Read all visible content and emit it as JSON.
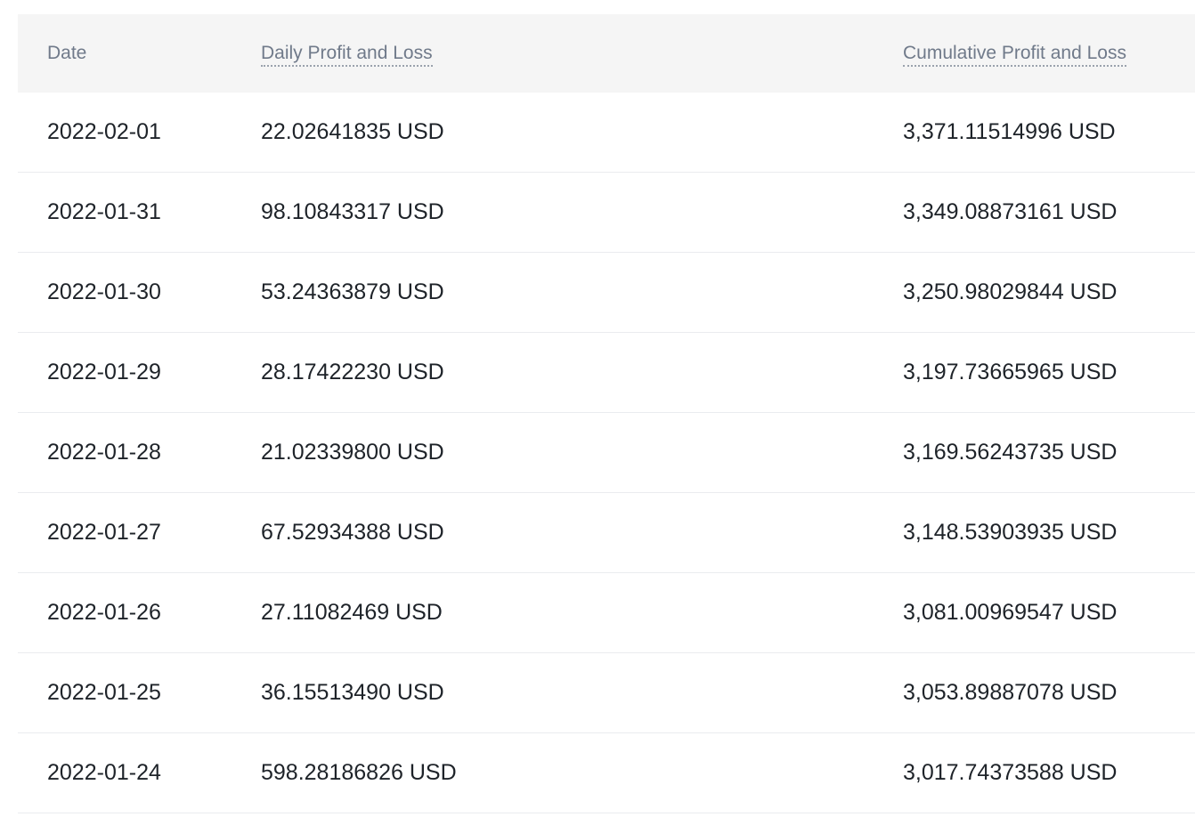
{
  "table": {
    "headers": {
      "date": "Date",
      "daily": "Daily Profit and Loss",
      "cumulative": "Cumulative Profit and Loss"
    },
    "rows": [
      {
        "date": "2022-02-01",
        "daily": "22.02641835 USD",
        "cumulative": "3,371.11514996 USD"
      },
      {
        "date": "2022-01-31",
        "daily": "98.10843317 USD",
        "cumulative": "3,349.08873161 USD"
      },
      {
        "date": "2022-01-30",
        "daily": "53.24363879 USD",
        "cumulative": "3,250.98029844 USD"
      },
      {
        "date": "2022-01-29",
        "daily": "28.17422230 USD",
        "cumulative": "3,197.73665965 USD"
      },
      {
        "date": "2022-01-28",
        "daily": "21.02339800 USD",
        "cumulative": "3,169.56243735 USD"
      },
      {
        "date": "2022-01-27",
        "daily": "67.52934388 USD",
        "cumulative": "3,148.53903935 USD"
      },
      {
        "date": "2022-01-26",
        "daily": "27.11082469 USD",
        "cumulative": "3,081.00969547 USD"
      },
      {
        "date": "2022-01-25",
        "daily": "36.15513490 USD",
        "cumulative": "3,053.89887078 USD"
      },
      {
        "date": "2022-01-24",
        "daily": "598.28186826 USD",
        "cumulative": "3,017.74373588 USD"
      }
    ]
  },
  "colors": {
    "header_bg": "#f5f5f5",
    "header_text": "#707a8a",
    "body_text": "#1e2329",
    "row_divider": "#eaecef"
  }
}
